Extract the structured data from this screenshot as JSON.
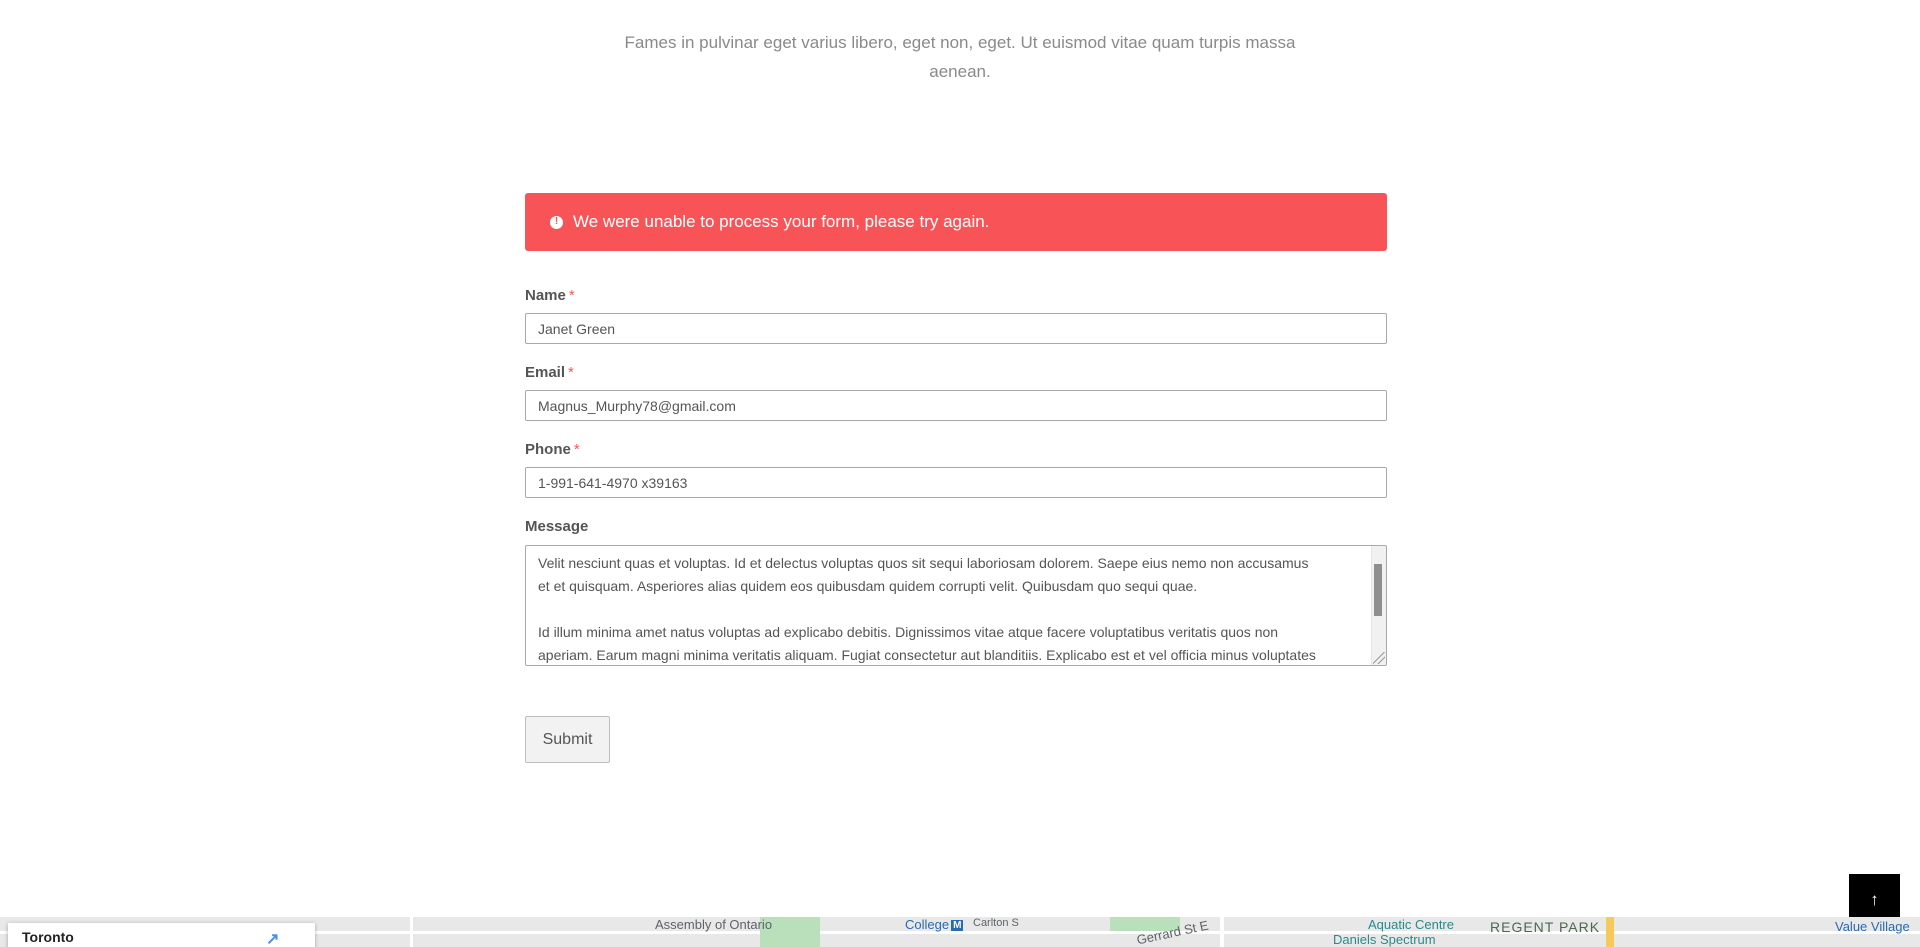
{
  "intro": {
    "line1": "Fames in pulvinar eget varius libero, eget non, eget. Ut euismod vitae quam turpis massa",
    "line2": "aenean."
  },
  "alert": {
    "icon": "exclamation-circle-icon",
    "message": "We were unable to process your form, please try again.",
    "color": "#f85458"
  },
  "form": {
    "name": {
      "label": "Name",
      "required_mark": "*",
      "value": "Janet Green"
    },
    "email": {
      "label": "Email",
      "required_mark": "*",
      "value": "Magnus_Murphy78@gmail.com"
    },
    "phone": {
      "label": "Phone",
      "required_mark": "*",
      "value": "1-991-641-4970 x39163"
    },
    "message": {
      "label": "Message",
      "line1": "Velit nesciunt quas et voluptas. Id et delectus voluptas quos sit sequi laboriosam dolorem. Saepe eius nemo non accusamus",
      "line2": "et et quisquam. Asperiores alias quidem eos quibusdam quidem corrupti velit. Quibusdam quo sequi quae.",
      "line3": "",
      "line4": "Id illum minima amet natus voluptas ad explicabo debitis. Dignissimos vitae atque facere voluptatibus veritatis quos non",
      "line5": "aperiam. Earum magni minima veritatis aliquam. Fugiat consectetur aut blanditiis. Explicabo est et vel officia minus voluptates"
    },
    "submit_label": "Submit"
  },
  "back_to_top": {
    "icon": "arrow-up-icon",
    "glyph": "↑"
  },
  "map": {
    "card_title": "Toronto",
    "card_icon": "directions-icon",
    "labels": {
      "assembly": "Assembly of Ontario",
      "college": "College",
      "metro_badge": "M",
      "carlton": "Carlton S",
      "gerrard": "Gerrard St E",
      "aquatic": "Aquatic Centre",
      "regent": "REGENT PARK",
      "daniels": "Daniels Spectrum",
      "value_village": "Value Village"
    }
  }
}
